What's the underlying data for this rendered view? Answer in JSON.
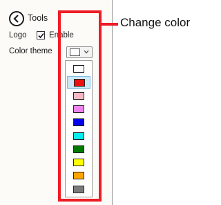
{
  "header": {
    "title": "Tools"
  },
  "logo": {
    "label": "Logo",
    "checked": true,
    "checkbox_label": "Enable"
  },
  "color_theme": {
    "label": "Color theme",
    "selected_color": "#ffffff",
    "options": [
      {
        "name": "white",
        "color": "#ffffff"
      },
      {
        "name": "red",
        "color": "#ee1111",
        "selected": true
      },
      {
        "name": "pink",
        "color": "#f7b8c6"
      },
      {
        "name": "violet",
        "color": "#ee82ee"
      },
      {
        "name": "blue",
        "color": "#0000ee"
      },
      {
        "name": "cyan",
        "color": "#00eeee"
      },
      {
        "name": "green",
        "color": "#007a00"
      },
      {
        "name": "yellow",
        "color": "#ffff00"
      },
      {
        "name": "orange",
        "color": "#ffa500"
      },
      {
        "name": "gray",
        "color": "#7a7a7a"
      }
    ]
  },
  "annotation": {
    "label": "Change color",
    "color": "#ee1c25"
  }
}
